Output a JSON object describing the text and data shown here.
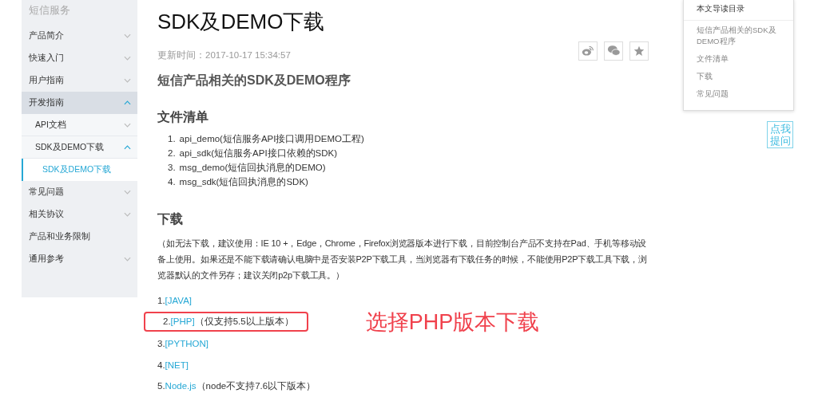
{
  "sidebar": {
    "title": "短信服务",
    "items": [
      {
        "label": "产品简介",
        "expanded": false,
        "selected": false
      },
      {
        "label": "快速入门",
        "expanded": false,
        "selected": false
      },
      {
        "label": "用户指南",
        "expanded": false,
        "selected": false
      },
      {
        "label": "开发指南",
        "expanded": true,
        "selected": false,
        "children": [
          {
            "label": "API文档",
            "expanded": false,
            "selected": false
          },
          {
            "label": "SDK及DEMO下载",
            "expanded": true,
            "selected": false,
            "children": [
              {
                "label": "SDK及DEMO下载",
                "selected": true
              }
            ]
          }
        ]
      },
      {
        "label": "常见问题",
        "expanded": false,
        "selected": false
      },
      {
        "label": "相关协议",
        "expanded": false,
        "selected": false
      },
      {
        "label": "产品和业务限制",
        "selected": false
      },
      {
        "label": "通用参考",
        "expanded": false,
        "selected": false
      }
    ]
  },
  "article": {
    "title": "SDK及DEMO下载",
    "updated": "更新时间：2017-10-17 15:34:57",
    "share_buttons": [
      {
        "kind": "weibo"
      },
      {
        "kind": "wechat"
      },
      {
        "kind": "favorite"
      }
    ],
    "subtitle": "短信产品相关的SDK及DEMO程序",
    "files_heading": "文件清单",
    "files": [
      {
        "number": "1.",
        "text": "api_demo(短信服务API接口调用DEMO工程)"
      },
      {
        "number": "2.",
        "text": "api_sdk(短信服务API接口依赖的SDK)"
      },
      {
        "number": "3.",
        "text": "msg_demo(短信回执消息的DEMO)"
      },
      {
        "number": "4.",
        "text": "msg_sdk(短信回执消息的SDK)"
      }
    ],
    "download_heading": "下载",
    "download_note": "（如无法下载，建议使用：IE 10 +，Edge，Chrome，Firefox浏览器版本进行下载，目前控制台产品不支持在Pad、手机等移动设备上使用。如果还是不能下载请确认电脑中是否安装P2P下载工具，当浏览器有下载任务的时候，不能使用P2P下载工具下载，浏览器默认的文件另存；建议关闭p2p下载工具。）",
    "downloads": [
      {
        "number": "1.",
        "link": "[JAVA]",
        "highlighted": false
      },
      {
        "number": "2.",
        "link": "[PHP]",
        "note": "（仅支持5.5以上版本）",
        "highlighted": true
      },
      {
        "number": "3.",
        "link": "[PYTHON]",
        "highlighted": false
      },
      {
        "number": "4.",
        "link": "[NET]",
        "highlighted": false
      },
      {
        "number": "5.",
        "link": "Node.js",
        "note": "（node不支持7.6以下版本）",
        "highlighted": false
      }
    ],
    "annotation": "选择PHP版本下载"
  },
  "toc": {
    "title": "本文导读目录",
    "items": [
      "短信产品相关的SDK及DEMO程序",
      "文件清单",
      "下载",
      "常见问题"
    ]
  },
  "ask_button": "点我提问"
}
